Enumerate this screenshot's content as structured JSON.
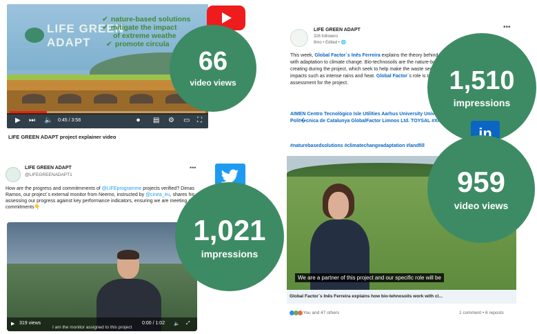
{
  "youtube": {
    "video_title_line1": "LIFE GREEN",
    "video_title_line2": "ADAPT",
    "bullets": [
      "nature-based solutions",
      "mitigate the impact",
      "of extreme weathe",
      "promote circula"
    ],
    "time": "0:45 / 3:58",
    "progress": 0.19,
    "caption": "LIFE GREEN ADAPT project explainer video",
    "stat_value": "66",
    "stat_label": "video views",
    "brand_color": "#ee1c1c"
  },
  "twitter": {
    "account_name": "LIFE GREEN ADAPT",
    "handle": "@LIFEGREENADAPT1",
    "text_parts": [
      "How are the progress and commitmments of ",
      "@LIFEprogramme",
      " projects verified? Dimas Ramos, our project´s external monitor from Neemo, instructed by ",
      "@cinea_eu",
      ", shares his role in assessing our progress against key performance indicators, ensuring we are meeting all our commitments👇"
    ],
    "views": "319 views",
    "time": "0:00 / 1:02",
    "subtitle": "I am the monitor assigned to this project",
    "stat_value": "1,021",
    "stat_label": "impressions",
    "brand_color": "#1d9bf0"
  },
  "linkedin": {
    "account_name": "LIFE GREEN ADAPT",
    "followers": "326 followers",
    "meta": "9mo • Edited •",
    "text_parts": [
      "This week, ",
      "Global Factor´s Inês Ferreira",
      " explains the theory behind how bio-technosoils help with adaptation to climate change. Bio-technosoils are the nature-based solutions that we are creating during the project, which seek to help make the waste sector resilient to climate change impacts such as intense rains and heat. ",
      "Global Factor",
      "´s role is to carry out the climate risk assessment for the project."
    ],
    "orgs": "AIMEN Centro Tecnológico Isle Utilities Aarhus University University Universitat Polit�cnica de Catalunya GlobalFactor Limnos Ltd. TOYSAL #Xiloga",
    "tags": "#naturebasedsolutions #climatechangeadaptation #landfill",
    "subtitle": "We are a partner of this project and our specific role will be",
    "caption": "Global Factor´s Inês Ferreira explains how bio-tehnosoils work with cl...",
    "reactions": "You and 47 others",
    "comments": "1 comment • 6 reposts",
    "impressions_value": "1,510",
    "impressions_label": "impressions",
    "views_value": "959",
    "views_label": "video views",
    "badge_text": "in",
    "brand_color": "#0a66c2"
  },
  "stat_circle_color": "#3d8b64"
}
